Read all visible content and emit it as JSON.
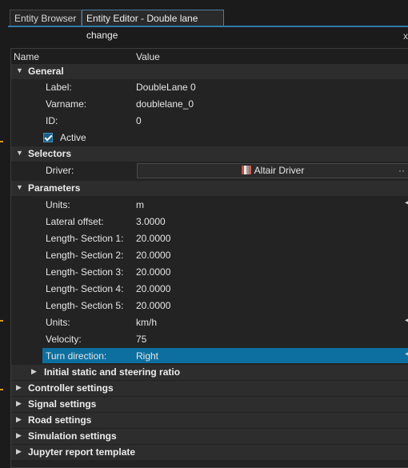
{
  "tabs": [
    {
      "label": "Entity Browser",
      "active": false
    },
    {
      "label": "Entity Editor - Double lane change",
      "active": true
    }
  ],
  "pin_glyph": "x",
  "header": {
    "name": "Name",
    "value": "Value"
  },
  "sections": {
    "general": {
      "title": "General",
      "label": {
        "name": "Label:",
        "value": "DoubleLane 0"
      },
      "varname": {
        "name": "Varname:",
        "value": "doublelane_0"
      },
      "id": {
        "name": "ID:",
        "value": "0"
      },
      "active": {
        "name": "Active",
        "checked": true
      }
    },
    "selectors": {
      "title": "Selectors",
      "driver": {
        "name": "Driver:",
        "value": "Altair Driver",
        "icon": "altair-driver-icon"
      }
    },
    "parameters": {
      "title": "Parameters",
      "rows": [
        {
          "name": "Units:",
          "value": "m"
        },
        {
          "name": "Lateral offset:",
          "value": "3.0000"
        },
        {
          "name": "Length- Section 1:",
          "value": "20.0000"
        },
        {
          "name": "Length- Section 2:",
          "value": "20.0000"
        },
        {
          "name": "Length- Section 3:",
          "value": "20.0000"
        },
        {
          "name": "Length- Section 4:",
          "value": "20.0000"
        },
        {
          "name": "Length- Section 5:",
          "value": "20.0000"
        },
        {
          "name": "Units:",
          "value": "km/h"
        },
        {
          "name": "Velocity:",
          "value": "75"
        },
        {
          "name": "Turn direction:",
          "value": "Right"
        }
      ],
      "subsection": "Initial static and steering ratio"
    },
    "collapsed": [
      "Controller settings",
      "Signal settings",
      "Road settings",
      "Simulation settings",
      "Jupyter report template"
    ]
  },
  "colors": {
    "selection": "#0c6f9f",
    "accent_tab": "#2f79a8",
    "edge_marker": "#d99b1a"
  }
}
